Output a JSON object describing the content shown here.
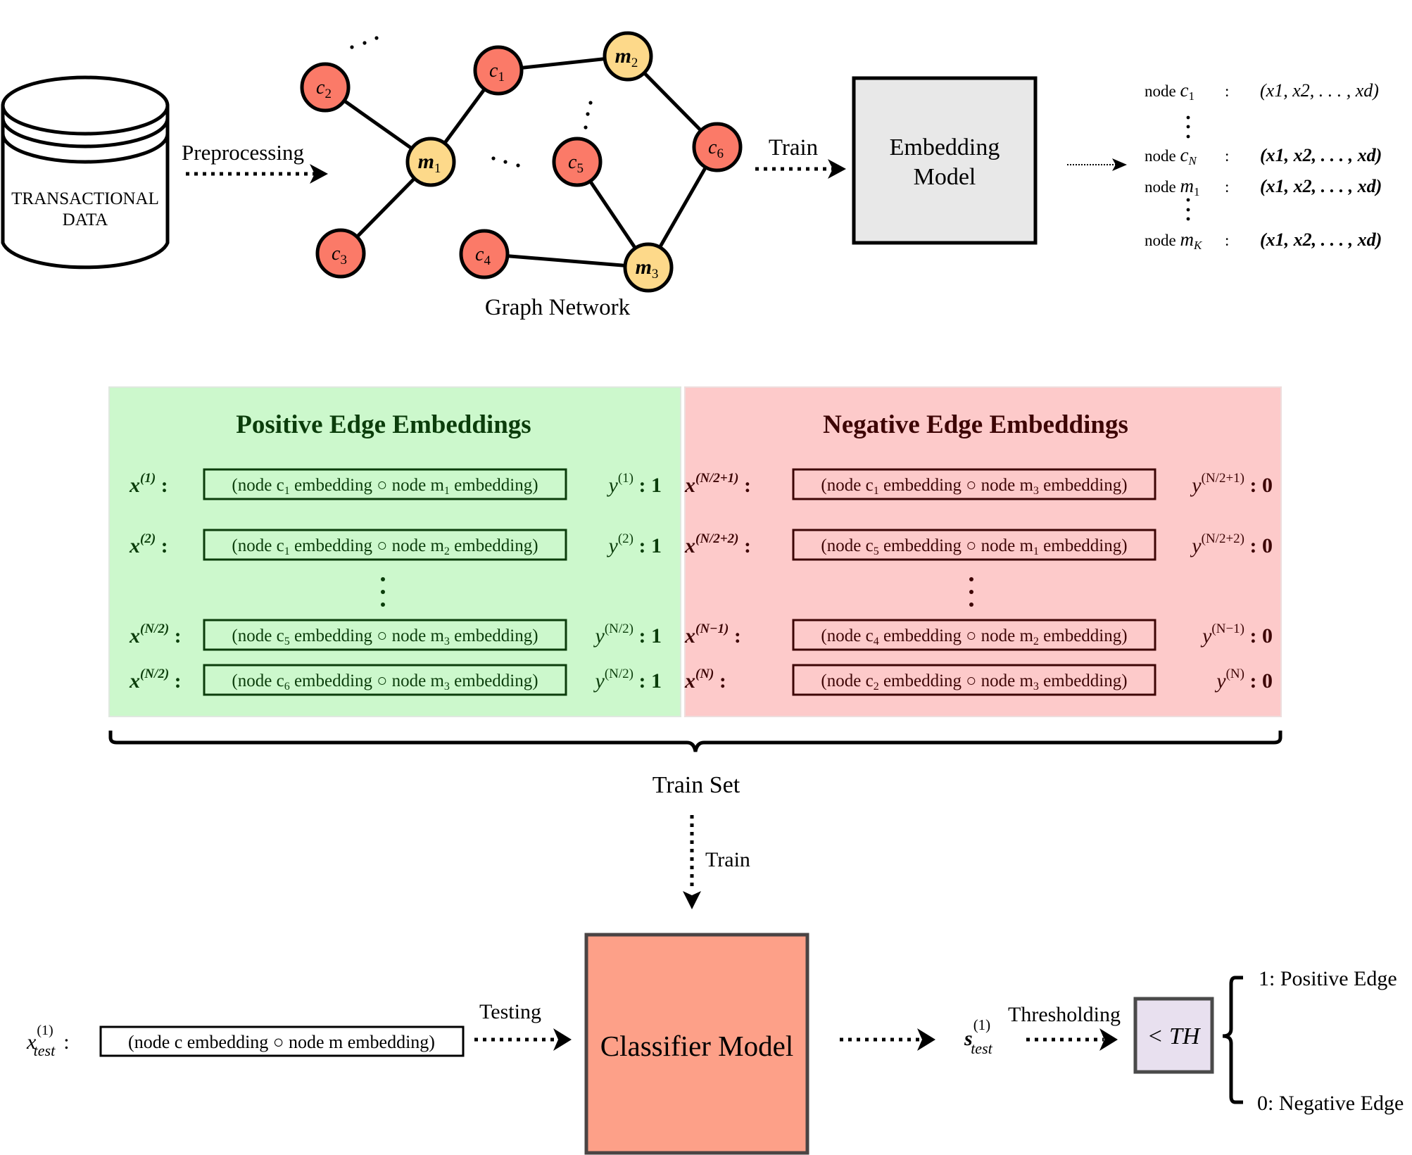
{
  "colors": {
    "customer_node": "#fb7a68",
    "merchant_node": "#fdd98a",
    "embedding_box": "#e8e8e8",
    "positive_panel": "#ccf8cc",
    "positive_text": "#0b3d0b",
    "negative_panel": "#fdcaca",
    "negative_text": "#3d0505",
    "classifier_box": "#fda088",
    "threshold_box": "#e8e0ef"
  },
  "database": {
    "label_line1": "TRANSACTIONAL",
    "label_line2": "DATA"
  },
  "arrows": {
    "preprocessing": "Preprocessing",
    "train_top": "Train",
    "train_down": "Train",
    "testing": "Testing",
    "thresholding": "Thresholding"
  },
  "graph": {
    "caption": "Graph Network",
    "nodes": [
      {
        "id": "c2",
        "base": "c",
        "sub": "2",
        "type": "customer"
      },
      {
        "id": "c1",
        "base": "c",
        "sub": "1",
        "type": "customer"
      },
      {
        "id": "m2",
        "base": "m",
        "sub": "2",
        "type": "merchant"
      },
      {
        "id": "m1",
        "base": "m",
        "sub": "1",
        "type": "merchant"
      },
      {
        "id": "c5",
        "base": "c",
        "sub": "5",
        "type": "customer"
      },
      {
        "id": "c6",
        "base": "c",
        "sub": "6",
        "type": "customer"
      },
      {
        "id": "c3",
        "base": "c",
        "sub": "3",
        "type": "customer"
      },
      {
        "id": "c4",
        "base": "c",
        "sub": "4",
        "type": "customer"
      },
      {
        "id": "m3",
        "base": "m",
        "sub": "3",
        "type": "merchant"
      }
    ],
    "edges": [
      [
        "c2",
        "m1"
      ],
      [
        "c3",
        "m1"
      ],
      [
        "c1",
        "m1"
      ],
      [
        "c1",
        "m2"
      ],
      [
        "m2",
        "c6"
      ],
      [
        "c6",
        "m3"
      ],
      [
        "c5",
        "m3"
      ],
      [
        "c4",
        "m3"
      ]
    ]
  },
  "embedding_model": {
    "line1": "Embedding",
    "line2": "Model"
  },
  "node_embeddings": [
    {
      "prefix": "node",
      "base": "c",
      "sub": "1",
      "vector": "(x1, x2, . . . , xd)"
    },
    {
      "prefix": "node",
      "base": "c",
      "sub": "N",
      "vector": "(x1, x2, . . . , xd)"
    },
    {
      "prefix": "node",
      "base": "m",
      "sub": "1",
      "vector": "(x1, x2, . . . , xd)"
    },
    {
      "prefix": "node",
      "base": "m",
      "sub": "K",
      "vector": "(x1, x2, . . . , xd)"
    }
  ],
  "positive_panel": {
    "title": "Positive Edge Embeddings",
    "rows": [
      {
        "x_sup": "(1)",
        "c": "1",
        "m": "1",
        "y_sup": "(1)",
        "label": "1"
      },
      {
        "x_sup": "(2)",
        "c": "1",
        "m": "2",
        "y_sup": "(2)",
        "label": "1"
      },
      {
        "x_sup": "(N/2)",
        "c": "5",
        "m": "3",
        "y_sup": "(N/2)",
        "label": "1"
      },
      {
        "x_sup": "(N/2)",
        "c": "6",
        "m": "3",
        "y_sup": "(N/2)",
        "label": "1"
      }
    ]
  },
  "negative_panel": {
    "title": "Negative Edge Embeddings",
    "rows": [
      {
        "x_sup": "(N/2+1)",
        "c": "1",
        "m": "3",
        "y_sup": "(N/2+1)",
        "label": "0"
      },
      {
        "x_sup": "(N/2+2)",
        "c": "5",
        "m": "1",
        "y_sup": "(N/2+2)",
        "label": "0"
      },
      {
        "x_sup": "(N−1)",
        "c": "4",
        "m": "2",
        "y_sup": "(N−1)",
        "label": "0"
      },
      {
        "x_sup": "(N)",
        "c": "2",
        "m": "3",
        "y_sup": "(N)",
        "label": "0"
      }
    ]
  },
  "embedding_text": {
    "part1": "(node c",
    "part2": " embedding ○ node m",
    "part3": " embedding)"
  },
  "train_set_label": "Train Set",
  "test_input": {
    "var": "x",
    "sup": "(1)",
    "sub": "test",
    "text": "(node c embedding ○ node m embedding)"
  },
  "classifier": {
    "label": "Classifier Model"
  },
  "score": {
    "var": "s",
    "sup": "(1)",
    "sub": "test"
  },
  "threshold": {
    "label": "< TH"
  },
  "outputs": {
    "positive": "1: Positive Edge",
    "negative": "0: Negative Edge"
  }
}
